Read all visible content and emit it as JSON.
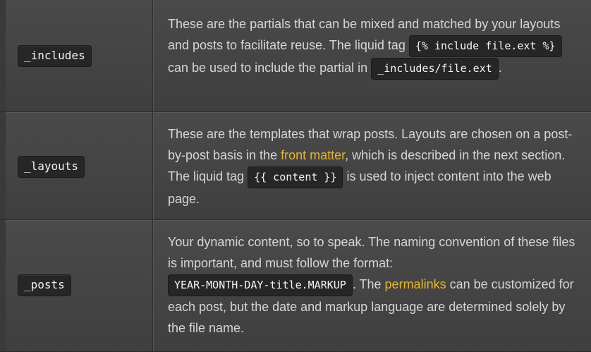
{
  "rows": [
    {
      "dir": "_includes",
      "parts": {
        "t1": "These are the partials that can be mixed and matched by your layouts and posts to facilitate reuse. The liquid tag ",
        "code1": "{% include file.ext %}",
        "t2": " can be used to include the partial in ",
        "code2": "_includes/file.ext",
        "t3": "."
      }
    },
    {
      "dir": "_layouts",
      "parts": {
        "t1": "These are the templates that wrap posts. Layouts are chosen on a post-by-post basis in the ",
        "link1": "front matter",
        "t2": ", which is described in the next section. The liquid tag ",
        "code1": "{{ content }}",
        "t3": " is used to inject content into the web page."
      }
    },
    {
      "dir": "_posts",
      "parts": {
        "t1": "Your dynamic content, so to speak. The naming convention of these files is important, and must follow the format: ",
        "code1": "YEAR-MONTH-DAY-title.MARKUP",
        "t2": ". The ",
        "link1": "permalinks",
        "t3": " can be customized for each post, but the date and markup language are determined solely by the file name."
      }
    }
  ],
  "colors": {
    "link": "#e8b62a",
    "code_bg": "#262626",
    "row_bg": "#454545",
    "text": "#d6d6d6"
  }
}
